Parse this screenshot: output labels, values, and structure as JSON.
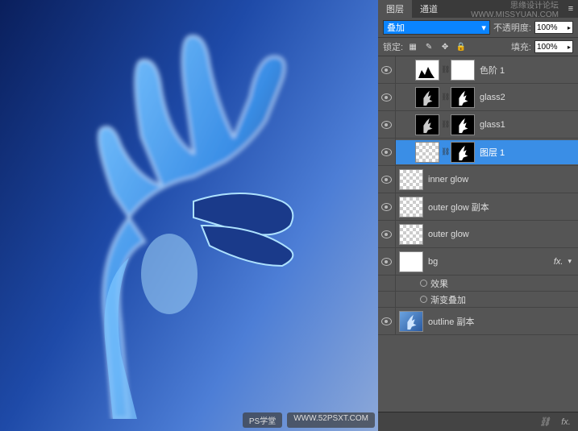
{
  "header": {
    "tab_layers": "图层",
    "tab_channels": "通道",
    "forum_title": "思缘设计论坛",
    "forum_url": "WWW.MISSYUAN.COM"
  },
  "options": {
    "blend_mode": "叠加",
    "opacity_label": "不透明度:",
    "opacity_value": "100%",
    "lock_label": "锁定:",
    "fill_label": "填充:",
    "fill_value": "100%"
  },
  "layers": [
    {
      "name": "色阶 1",
      "type": "adjustment",
      "visible": true
    },
    {
      "name": "glass2",
      "type": "masked-hand",
      "visible": true
    },
    {
      "name": "glass1",
      "type": "masked-hand",
      "visible": true
    },
    {
      "name": "图层 1",
      "type": "selected-hand",
      "visible": true,
      "selected": true
    },
    {
      "name": "inner glow",
      "type": "transparent",
      "visible": true
    },
    {
      "name": "outer glow 副本",
      "type": "transparent",
      "visible": true
    },
    {
      "name": "outer glow",
      "type": "transparent",
      "visible": true
    },
    {
      "name": "bg",
      "type": "white-fx",
      "visible": true,
      "fx": true
    },
    {
      "name": "outline 副本",
      "type": "outline",
      "visible": true
    }
  ],
  "fx": {
    "effects_label": "效果",
    "gradient_overlay": "渐变叠加"
  },
  "watermarks": {
    "ps_school": "PS学堂",
    "domain": "WWW.52PSXT.COM"
  },
  "footer": {
    "fx": "fx."
  }
}
